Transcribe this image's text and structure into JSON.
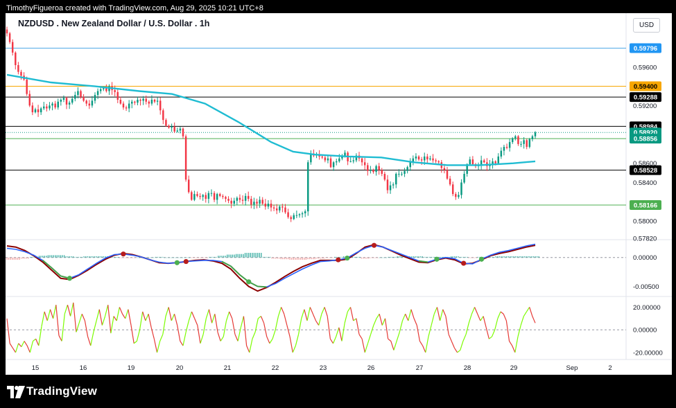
{
  "header": {
    "attribution": "TimothyFigueroa created with TradingView.com, Aug 29, 2025 10:21 UTC+8"
  },
  "toolbar": {
    "symbol_title": "NZDUSD . New Zealand Dollar / U.S. Dollar . 1h",
    "currency": "USD"
  },
  "footer": {
    "brand": "TradingView"
  },
  "colors": {
    "up_candle": "#089981",
    "down_candle": "#f23645",
    "ma_line": "#1fbcd2",
    "macd_line": "#2962ff",
    "signal_line": "#8b0000",
    "cross_up": "#4caf50",
    "cross_down": "#b71c1c",
    "osc_up": "#7cfc00",
    "osc_down": "#e53935"
  },
  "chart_data": [
    {
      "type": "candlestick",
      "pane": "price",
      "title": "NZDUSD . New Zealand Dollar / U.S. Dollar . 1h",
      "ylim": [
        0.5782,
        0.5998
      ],
      "x_ticks": [
        "15",
        "16",
        "19",
        "20",
        "21",
        "22",
        "23",
        "26",
        "27",
        "28",
        "29",
        "Sep",
        "2"
      ],
      "y_ticks": [
        "0.59600",
        "0.59200",
        "0.58600",
        "0.58400",
        "0.58000",
        "0.57820"
      ],
      "close_series": [
        0.5995,
        0.5986,
        0.5975,
        0.5962,
        0.5955,
        0.5951,
        0.5947,
        0.5932,
        0.592,
        0.5913,
        0.5916,
        0.5913,
        0.5917,
        0.5919,
        0.5917,
        0.592,
        0.5922,
        0.5918,
        0.5924,
        0.5926,
        0.5928,
        0.5921,
        0.5923,
        0.5927,
        0.5931,
        0.5935,
        0.5929,
        0.5925,
        0.5922,
        0.592,
        0.5925,
        0.5931,
        0.5935,
        0.5937,
        0.5938,
        0.5935,
        0.594,
        0.5936,
        0.5934,
        0.5926,
        0.5922,
        0.5918,
        0.5917,
        0.5922,
        0.5924,
        0.5923,
        0.5926,
        0.5925,
        0.5927,
        0.5924,
        0.5922,
        0.5926,
        0.5924,
        0.5925,
        0.5915,
        0.5905,
        0.5899,
        0.5897,
        0.5898,
        0.5893,
        0.5894,
        0.5896,
        0.5888,
        0.5843,
        0.583,
        0.5822,
        0.5828,
        0.5826,
        0.5825,
        0.5827,
        0.5823,
        0.5829,
        0.5829,
        0.5822,
        0.5828,
        0.5826,
        0.5825,
        0.5823,
        0.5821,
        0.5818,
        0.5821,
        0.5824,
        0.5822,
        0.5821,
        0.5826,
        0.5823,
        0.5817,
        0.582,
        0.5818,
        0.5822,
        0.5818,
        0.5815,
        0.5818,
        0.5814,
        0.5813,
        0.5811,
        0.5815,
        0.5814,
        0.5809,
        0.5804,
        0.5802,
        0.5806,
        0.5806,
        0.5807,
        0.5808,
        0.581,
        0.5861,
        0.587,
        0.5868,
        0.5869,
        0.5867,
        0.5866,
        0.5863,
        0.5865,
        0.5856,
        0.5861,
        0.5862,
        0.5865,
        0.5867,
        0.5871,
        0.5862,
        0.5862,
        0.5863,
        0.5868,
        0.5865,
        0.5861,
        0.5858,
        0.5852,
        0.5853,
        0.5851,
        0.5857,
        0.5853,
        0.5849,
        0.5843,
        0.5832,
        0.5837,
        0.5838,
        0.5849,
        0.5849,
        0.5849,
        0.5852,
        0.5856,
        0.5861,
        0.5865,
        0.5867,
        0.5864,
        0.5863,
        0.5867,
        0.5864,
        0.5865,
        0.5863,
        0.5862,
        0.5861,
        0.5855,
        0.5853,
        0.5844,
        0.5838,
        0.5828,
        0.5825,
        0.5827,
        0.584,
        0.5849,
        0.5859,
        0.5864,
        0.5859,
        0.5857,
        0.5858,
        0.5863,
        0.5861,
        0.5857,
        0.5859,
        0.5862,
        0.586,
        0.5867,
        0.5873,
        0.5877,
        0.5876,
        0.5882,
        0.5886,
        0.5888,
        0.588,
        0.588,
        0.5884,
        0.5877,
        0.5885,
        0.5888,
        0.5892
      ],
      "moving_average": {
        "points": [
          [
            0,
            0.5952
          ],
          [
            20,
            0.5944
          ],
          [
            40,
            0.594
          ],
          [
            60,
            0.5935
          ],
          [
            75,
            0.5932
          ],
          [
            90,
            0.5922
          ],
          [
            105,
            0.5903
          ],
          [
            120,
            0.5882
          ],
          [
            130,
            0.5872
          ],
          [
            140,
            0.5869
          ],
          [
            155,
            0.5867
          ],
          [
            170,
            0.5866
          ],
          [
            185,
            0.5861
          ],
          [
            200,
            0.5858
          ],
          [
            215,
            0.5858
          ],
          [
            230,
            0.586
          ],
          [
            240,
            0.5862
          ]
        ]
      },
      "horizontal_lines": [
        {
          "value": "0.59796",
          "line_color": "#4fa8e6",
          "tag_color": "#2196f3",
          "text_color": "#ffffff"
        },
        {
          "value": "0.59400",
          "line_color": "#f7a600",
          "tag_color": "#f7a600",
          "text_color": "#000000"
        },
        {
          "value": "0.59288",
          "line_color": "#000000",
          "tag_color": "#000000",
          "text_color": "#ffffff"
        },
        {
          "value": "0.58984",
          "line_color": "#000000",
          "tag_color": "#000000",
          "text_color": "#ffffff"
        },
        {
          "value": "0.58920",
          "line_color": "#089981",
          "tag_color": "#089981",
          "text_color": "#ffffff",
          "dotted": true
        },
        {
          "value": "0.58856",
          "line_color": "#4caf50",
          "tag_color": "#089981",
          "text_color": "#ffffff"
        },
        {
          "value": "0.58528",
          "line_color": "#000000",
          "tag_color": "#000000",
          "text_color": "#ffffff"
        },
        {
          "value": "0.58166",
          "line_color": "#4caf50",
          "tag_color": "#4caf50",
          "text_color": "#ffffff"
        }
      ]
    },
    {
      "type": "line",
      "pane": "macd",
      "ylim": [
        -0.0065,
        0.0026
      ],
      "y_ticks": [
        "0.00000",
        "-0.00500"
      ],
      "macd": [
        0.0016,
        0.0014,
        0.001,
        0.0004,
        -0.0005,
        -0.0018,
        -0.0032,
        -0.0036,
        -0.003,
        -0.002,
        -0.001,
        -0.0001,
        0.0005,
        0.0006,
        0.0004,
        0.0001,
        -0.0004,
        -0.0008,
        -0.001,
        -0.0009,
        -0.0007,
        -0.0006,
        -0.0005,
        -0.0005,
        -0.0007,
        -0.0015,
        -0.003,
        -0.0042,
        -0.005,
        -0.0051,
        -0.0045,
        -0.0036,
        -0.0028,
        -0.002,
        -0.0013,
        -0.0007,
        -0.0006,
        -0.0004,
        -0.0001,
        0.0008,
        0.0016,
        0.0021,
        0.0018,
        0.0012,
        0.0006,
        0.0,
        -0.0006,
        -0.0008,
        -0.0003,
        0.0,
        -0.0002,
        -0.001,
        -0.0011,
        -0.0003,
        0.0004,
        0.0009,
        0.0012,
        0.0016,
        0.002,
        0.0023
      ],
      "signal": [
        0.002,
        0.0018,
        0.0012,
        0.0003,
        -0.0008,
        -0.0022,
        -0.0036,
        -0.0038,
        -0.0031,
        -0.0022,
        -0.0012,
        -0.0003,
        0.0004,
        0.0007,
        0.0005,
        0.0001,
        -0.0004,
        -0.0009,
        -0.001,
        -0.0009,
        -0.0007,
        -0.0005,
        -0.0004,
        -0.0006,
        -0.001,
        -0.002,
        -0.0036,
        -0.005,
        -0.0058,
        -0.0052,
        -0.0043,
        -0.0033,
        -0.0024,
        -0.0016,
        -0.001,
        -0.0005,
        -0.0005,
        -0.0005,
        -0.0003,
        0.0007,
        0.0018,
        0.0022,
        0.0018,
        0.0011,
        0.0004,
        -0.0002,
        -0.0008,
        -0.0009,
        -0.0004,
        -0.0001,
        -0.0004,
        -0.0011,
        -0.001,
        -0.0004,
        0.0003,
        0.0007,
        0.001,
        0.0014,
        0.0018,
        0.0021
      ],
      "histogram": [
        -0.0004,
        -0.0004,
        -0.0002,
        0.0001,
        0.0003,
        0.0004,
        0.0004,
        0.0002,
        0.0001,
        0.0002,
        0.0002,
        0.0002,
        0.0001,
        -0.0001,
        -0.0001,
        0.0,
        0.0,
        0.0001,
        0.0,
        0.0,
        0.0,
        -0.0001,
        -0.0001,
        0.0001,
        0.0003,
        0.0005,
        0.0006,
        0.0008,
        0.0008,
        0.0001,
        -0.0002,
        -0.0003,
        -0.0004,
        -0.0004,
        -0.0003,
        -0.0002,
        -0.0001,
        0.0001,
        0.0002,
        0.0001,
        -0.0002,
        -0.0001,
        0.0,
        0.0001,
        0.0002,
        0.0002,
        0.0002,
        0.0001,
        0.0001,
        0.0001,
        0.0002,
        0.0001,
        -0.0001,
        0.0001,
        0.0001,
        0.0002,
        0.0002,
        0.0002,
        0.0002,
        0.0002
      ],
      "cross_markers": [
        {
          "i": 7,
          "dir": "up"
        },
        {
          "i": 13,
          "dir": "down"
        },
        {
          "i": 19,
          "dir": "up"
        },
        {
          "i": 20,
          "dir": "down"
        },
        {
          "i": 27,
          "dir": "up"
        },
        {
          "i": 37,
          "dir": "down"
        },
        {
          "i": 38,
          "dir": "up"
        },
        {
          "i": 41,
          "dir": "down"
        },
        {
          "i": 48,
          "dir": "up"
        },
        {
          "i": 51,
          "dir": "down"
        },
        {
          "i": 53,
          "dir": "up"
        }
      ]
    },
    {
      "type": "line",
      "pane": "oscillator",
      "ylim": [
        -25,
        27
      ],
      "y_ticks": [
        "20.00000",
        "0.00000",
        "-20.00000"
      ],
      "values": [
        10,
        -12,
        -16,
        -20,
        -12,
        -15,
        -10,
        -14,
        -20,
        -10,
        -8,
        -14,
        3,
        16,
        8,
        18,
        10,
        22,
        -5,
        -10,
        14,
        22,
        12,
        24,
        -2,
        6,
        14,
        8,
        -6,
        -14,
        -2,
        8,
        18,
        4,
        12,
        22,
        -3,
        12,
        8,
        20,
        14,
        10,
        18,
        4,
        -12,
        -10,
        0,
        16,
        8,
        14,
        2,
        -8,
        -20,
        -10,
        -4,
        12,
        20,
        8,
        14,
        4,
        -10,
        -14,
        -2,
        8,
        16,
        10,
        4,
        -12,
        -4,
        10,
        18,
        6,
        14,
        -2,
        -10,
        -6,
        8,
        16,
        10,
        -4,
        -10,
        2,
        12,
        -14,
        -20,
        -8,
        -2,
        10,
        12,
        6,
        -6,
        -12,
        -8,
        0,
        12,
        20,
        14,
        4,
        -6,
        -20,
        -14,
        -4,
        10,
        18,
        8,
        20,
        14,
        8,
        4,
        14,
        20,
        12,
        -8,
        -12,
        -6,
        2,
        -10,
        6,
        16,
        20,
        8,
        10,
        -4,
        -8,
        -20,
        -12,
        -4,
        4,
        10,
        14,
        4,
        10,
        -8,
        -10,
        -18,
        -10,
        -2,
        8,
        14,
        8,
        18,
        10,
        4,
        -10,
        -14,
        -20,
        -6,
        4,
        14,
        20,
        8,
        18,
        12,
        -4,
        -10,
        -16,
        -20,
        -18,
        -10,
        -4,
        6,
        14,
        20,
        14,
        8,
        12,
        2,
        -8,
        -6,
        0,
        10,
        16,
        14,
        8,
        -10,
        -14,
        -20,
        -6,
        4,
        12,
        16,
        20,
        12,
        6
      ],
      "colored_by": "direction"
    }
  ]
}
